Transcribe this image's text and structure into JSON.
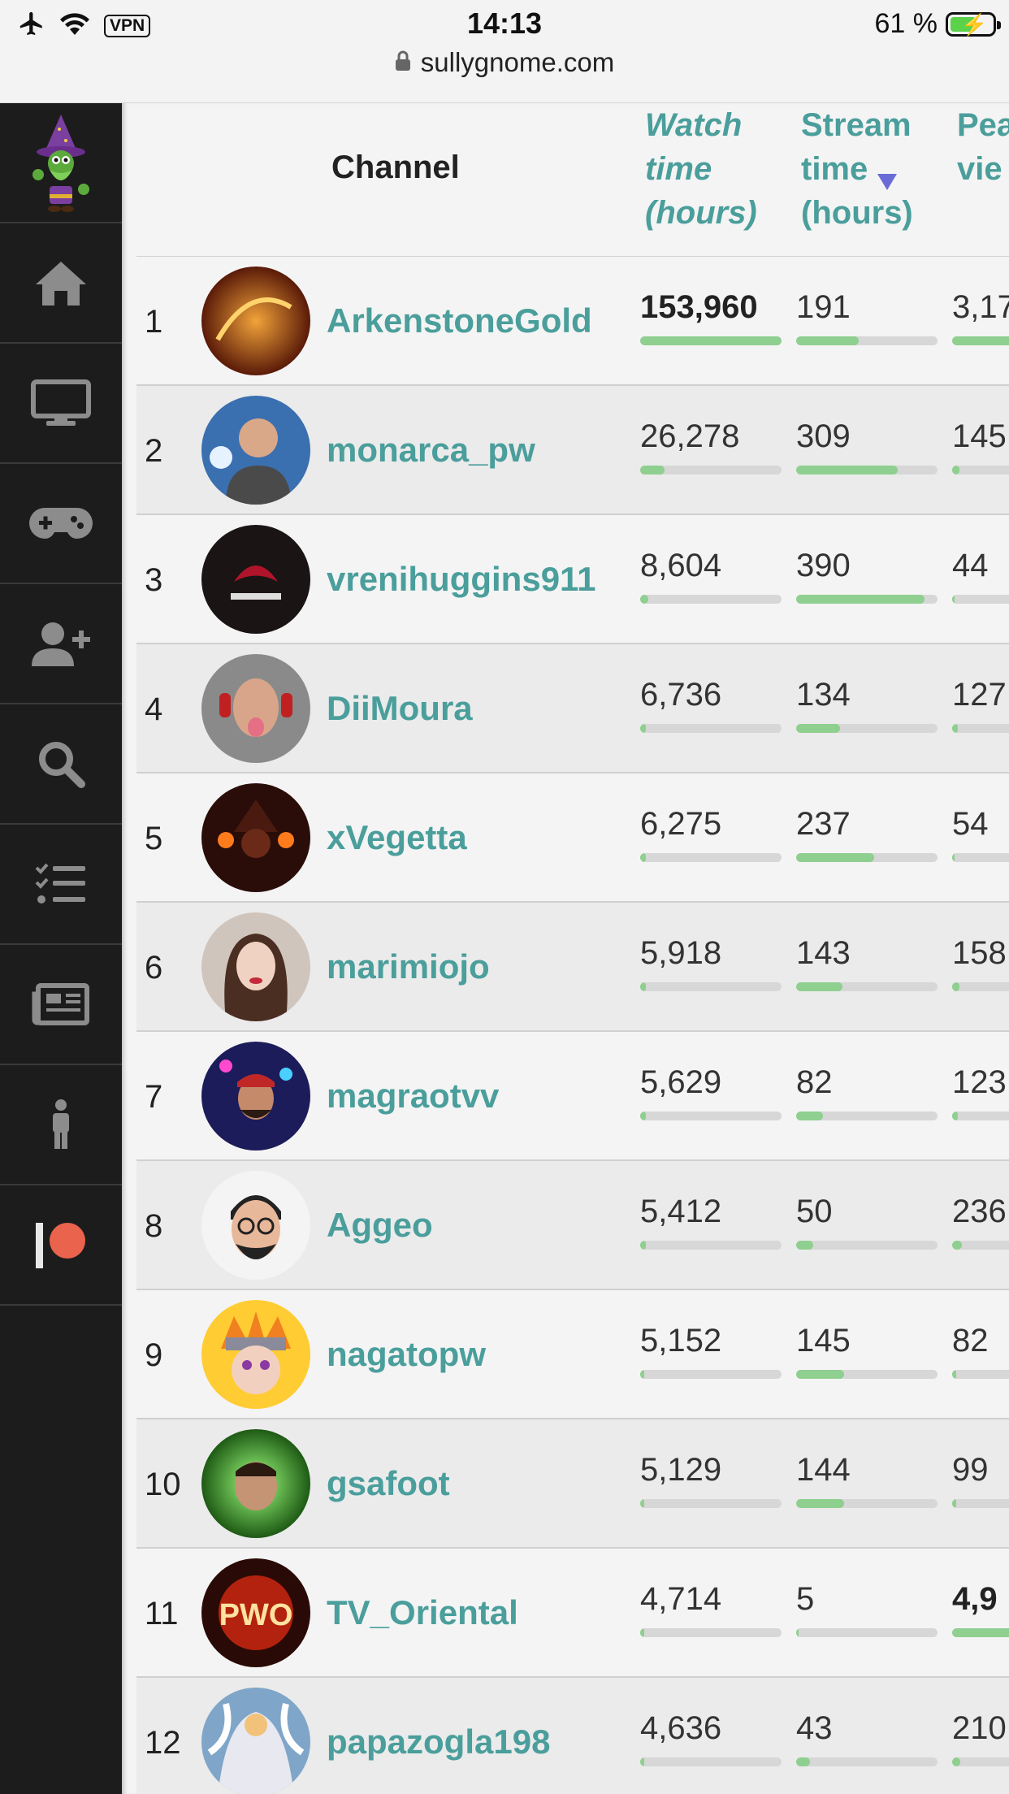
{
  "status": {
    "time": "14:13",
    "battery": "61 %",
    "battery_level": 0.61,
    "vpn": "VPN",
    "url": "sullygnome.com"
  },
  "sidebar": {
    "items": [
      {
        "icon": "wizard-logo-icon"
      },
      {
        "icon": "home-icon"
      },
      {
        "icon": "monitor-icon"
      },
      {
        "icon": "gamepad-icon"
      },
      {
        "icon": "add-user-icon"
      },
      {
        "icon": "search-icon"
      },
      {
        "icon": "checklist-icon"
      },
      {
        "icon": "newspaper-icon"
      },
      {
        "icon": "person-icon"
      },
      {
        "icon": "patreon-icon"
      }
    ]
  },
  "table": {
    "headers": {
      "channel": "Channel",
      "watch": [
        "Watch",
        "time",
        "(hours)"
      ],
      "stream": [
        "Stream",
        "time",
        "(hours)"
      ],
      "peak": [
        "Pea",
        "vie"
      ]
    },
    "rows": [
      {
        "rank": "1",
        "channel": "ArkenstoneGold",
        "watch": "153,960",
        "watch_bold": true,
        "watch_frac": 1.0,
        "stream": "191",
        "stream_frac": 0.44,
        "peak": "3,17",
        "peak_bold": false,
        "peak_frac": 1.0
      },
      {
        "rank": "2",
        "channel": "monarca_pw",
        "watch": "26,278",
        "watch_frac": 0.17,
        "stream": "309",
        "stream_frac": 0.72,
        "peak": "145",
        "peak_frac": 0.05
      },
      {
        "rank": "3",
        "channel": "vrenihuggins911",
        "watch": "8,604",
        "watch_frac": 0.06,
        "stream": "390",
        "stream_frac": 0.91,
        "peak": "44",
        "peak_frac": 0.02
      },
      {
        "rank": "4",
        "channel": "DiiMoura",
        "watch": "6,736",
        "watch_frac": 0.04,
        "stream": "134",
        "stream_frac": 0.31,
        "peak": "127",
        "peak_frac": 0.04
      },
      {
        "rank": "5",
        "channel": "xVegetta",
        "watch": "6,275",
        "watch_frac": 0.04,
        "stream": "237",
        "stream_frac": 0.55,
        "peak": "54",
        "peak_frac": 0.02
      },
      {
        "rank": "6",
        "channel": "marimiojo",
        "watch": "5,918",
        "watch_frac": 0.04,
        "stream": "143",
        "stream_frac": 0.33,
        "peak": "158",
        "peak_frac": 0.05
      },
      {
        "rank": "7",
        "channel": "magraotvv",
        "watch": "5,629",
        "watch_frac": 0.04,
        "stream": "82",
        "stream_frac": 0.19,
        "peak": "123",
        "peak_frac": 0.04
      },
      {
        "rank": "8",
        "channel": "Aggeo",
        "watch": "5,412",
        "watch_frac": 0.04,
        "stream": "50",
        "stream_frac": 0.12,
        "peak": "236",
        "peak_frac": 0.07
      },
      {
        "rank": "9",
        "channel": "nagatopw",
        "watch": "5,152",
        "watch_frac": 0.03,
        "stream": "145",
        "stream_frac": 0.34,
        "peak": "82",
        "peak_frac": 0.03
      },
      {
        "rank": "10",
        "channel": "gsafoot",
        "watch": "5,129",
        "watch_frac": 0.03,
        "stream": "144",
        "stream_frac": 0.34,
        "peak": "99",
        "peak_frac": 0.03
      },
      {
        "rank": "11",
        "channel": "TV_Oriental",
        "watch": "4,714",
        "watch_frac": 0.03,
        "stream": "5",
        "stream_frac": 0.02,
        "peak": "4,9",
        "peak_bold": true,
        "peak_frac": 1.0
      },
      {
        "rank": "12",
        "channel": "papazogla198",
        "watch": "4,636",
        "watch_frac": 0.03,
        "stream": "43",
        "stream_frac": 0.1,
        "peak": "210",
        "peak_frac": 0.06
      }
    ]
  },
  "colors": {
    "accent": "#4a9e9b",
    "bar_fill": "#8fcf8f",
    "bar_track": "#d7d7d7",
    "sidebar_bg": "#1c1c1c",
    "sort_active": "#6b6bd8",
    "patreon": "#e9634d"
  }
}
